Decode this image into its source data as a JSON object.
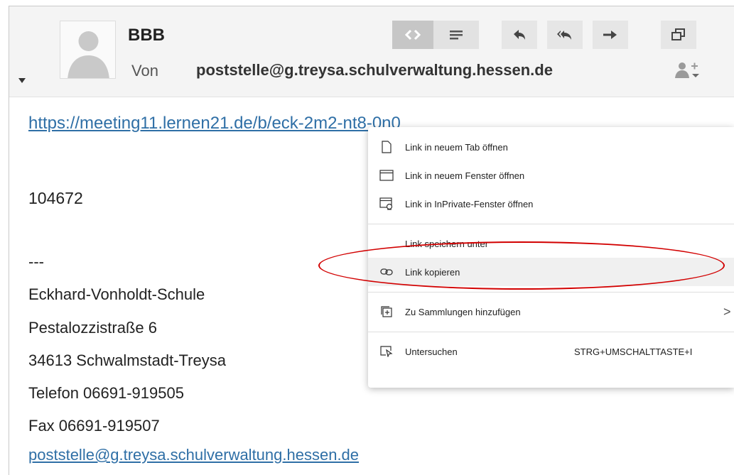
{
  "header": {
    "subject": "BBB",
    "from_label": "Von",
    "from_address": "poststelle@g.treysa.schulverwaltung.hessen.de",
    "toolbar": {
      "html_view": "html-view-icon",
      "text_view": "text-view-icon",
      "reply": "reply-icon",
      "reply_all": "reply-all-icon",
      "forward": "forward-icon",
      "new_window": "new-window-icon"
    }
  },
  "body": {
    "link": "https://meeting11.lernen21.de/b/eck-2m2-nt8-0n0",
    "code": "104672",
    "separator": "---",
    "signature": [
      "Eckhard-Vonholdt-Schule",
      "Pestalozzistraße 6",
      "34613 Schwalmstadt-Treysa",
      "Telefon  06691-919505",
      "Fax  06691-919507"
    ],
    "email_link": "poststelle@g.treysa.schulverwaltung.hessen.de"
  },
  "context_menu": {
    "items": [
      {
        "label": "Link in neuem Tab öffnen",
        "icon": "new-tab-icon"
      },
      {
        "label": "Link in neuem Fenster öffnen",
        "icon": "new-window-icon"
      },
      {
        "label": "Link in InPrivate-Fenster öffnen",
        "icon": "inprivate-icon"
      },
      {
        "label": "Link speichern unter",
        "icon": ""
      },
      {
        "label": "Link kopieren",
        "icon": "link-icon",
        "highlighted": true
      },
      {
        "label": "Zu Sammlungen hinzufügen",
        "icon": "collections-icon",
        "submenu": ">"
      },
      {
        "label": "Untersuchen",
        "icon": "inspect-icon",
        "shortcut": "STRG+UMSCHALTTASTE+I"
      }
    ]
  },
  "colors": {
    "link": "#2f6fa6",
    "highlight_oval": "#d20000",
    "header_bg": "#f4f4f4"
  }
}
